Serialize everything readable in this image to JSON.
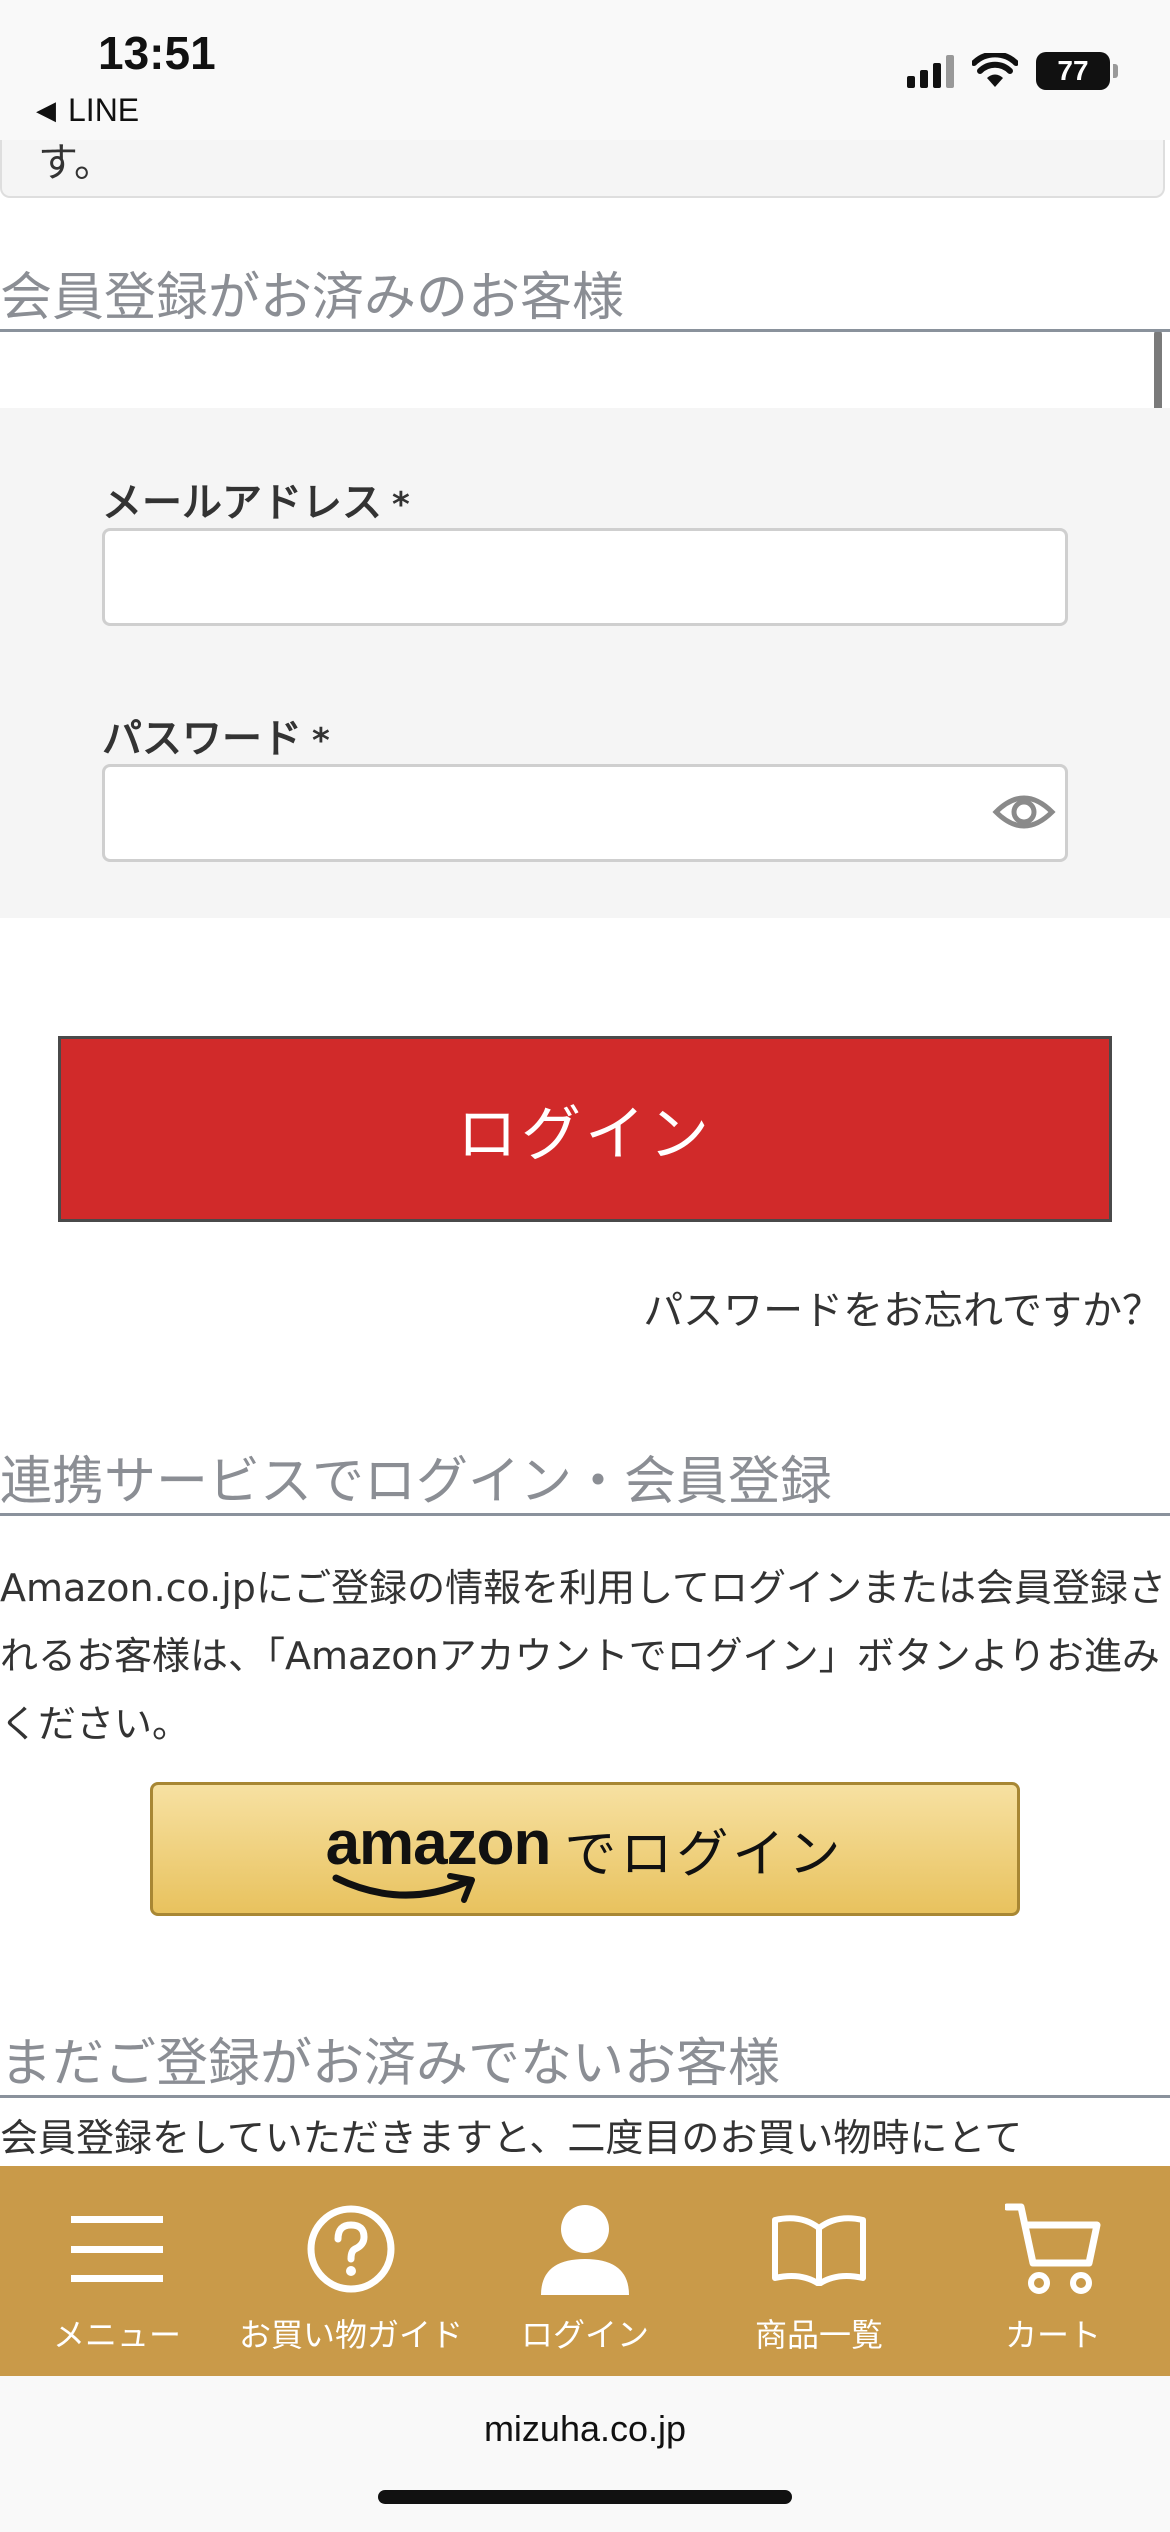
{
  "status_bar": {
    "time": "13:51",
    "back_app": "LINE",
    "battery": "77"
  },
  "previous_section": {
    "tail_text": "す。"
  },
  "member_login": {
    "heading": "会員登録がお済みのお客様",
    "email_label": "メールアドレス",
    "password_label": "パスワード",
    "required_mark": "*",
    "email_value": "",
    "password_value": "",
    "login_button": "ログイン",
    "forgot_password": "パスワードをお忘れですか？"
  },
  "linked_services": {
    "heading": "連携サービスでログイン・会員登録",
    "description": "Amazon.co.jpにご登録の情報を利用してログインまたは会員登録されるお客様は、「Amazonアカウントでログイン」ボタンよりお進みください。",
    "amazon_logo_text": "amazon",
    "amazon_button_suffix": "でログイン"
  },
  "new_customer": {
    "heading": "まだご登録がお済みでないお客様",
    "description": "会員登録をしていただきますと、二度目のお買い物時にとて"
  },
  "tab_bar": {
    "items": [
      {
        "label": "メニュー",
        "icon": "menu-icon"
      },
      {
        "label": "お買い物ガイド",
        "icon": "help-icon"
      },
      {
        "label": "ログイン",
        "icon": "user-icon"
      },
      {
        "label": "商品一覧",
        "icon": "book-icon"
      },
      {
        "label": "カート",
        "icon": "cart-icon"
      }
    ]
  },
  "browser": {
    "url": "mizuha.co.jp"
  },
  "colors": {
    "login_button": "#d12a2a",
    "tab_bar": "#c99a49",
    "heading_text": "#8b8e94",
    "amazon_button": "#f0d27e"
  }
}
